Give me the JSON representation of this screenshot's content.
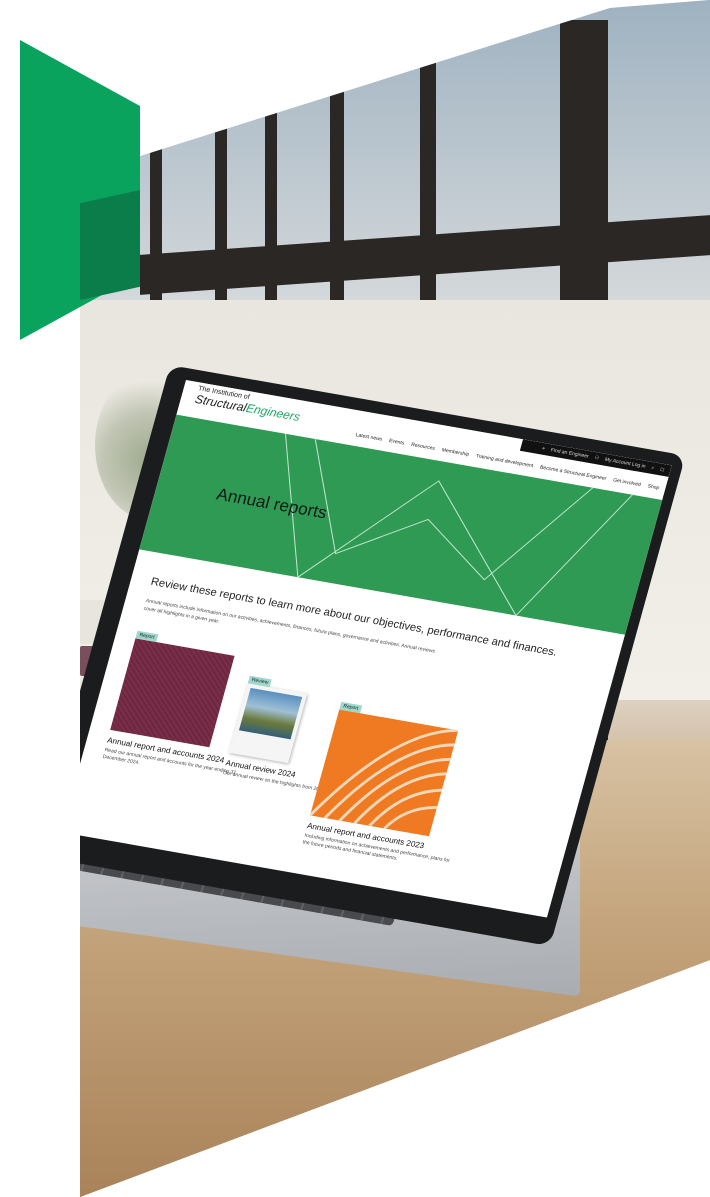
{
  "site": {
    "logo_line1": "The Institution of",
    "logo_part1": "Structural",
    "logo_part2": "Engineers",
    "utility": {
      "find_engineer": "Find an Engineer",
      "account": "My Account Log in"
    },
    "nav": [
      "Latest news",
      "Events",
      "Resources",
      "Membership",
      "Training and development",
      "Become a Structural Engineer",
      "Get involved",
      "Shop"
    ],
    "hero_title": "Annual reports",
    "intro_heading": "Review these reports to learn more about our objectives, performance and finances.",
    "intro_body": "Annual reports include information on our activities, achievements, finances, future plans, governance and activities. Annual reviews cover all highlights in a given year.",
    "cards": [
      {
        "tag": "Report",
        "title": "Annual report and accounts 2024",
        "description": "Read our annual report and accounts for the year ending 31 December 2024."
      },
      {
        "tag": "Review",
        "title": "Annual review 2024",
        "description": "Our annual review on the highlights from 2024."
      },
      {
        "tag": "Report",
        "title": "Annual report and accounts 2023",
        "description": "Including information on achievements and performance, plans for the future periods and financial statements."
      }
    ]
  },
  "colors": {
    "brand_green": "#0aa35e",
    "brand_green_dark": "#0b7d4b",
    "hero_green": "#2f9a53",
    "report_2023_orange": "#ef7a22",
    "report_2024_burgundy": "#6d2740"
  },
  "icons": [
    "search-icon",
    "user-icon",
    "pin-icon",
    "bag-icon"
  ]
}
